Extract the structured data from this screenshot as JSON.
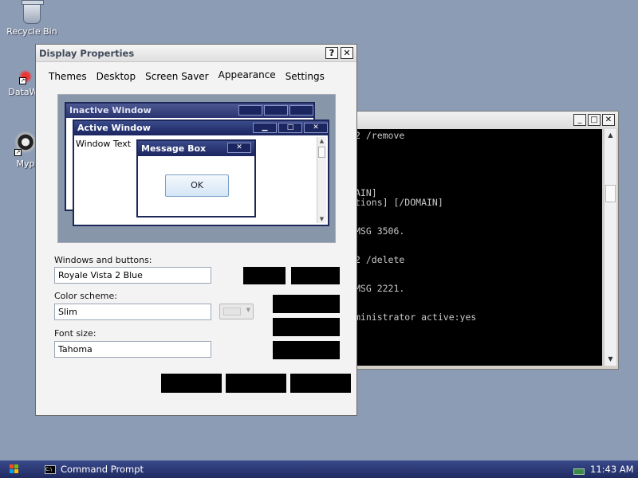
{
  "desktop": {
    "icons": [
      {
        "label": "Recycle Bin",
        "icon": "recycle-bin-icon"
      },
      {
        "label": "DataWa",
        "icon": "datawa-app-icon"
      },
      {
        "label": "Myp",
        "icon": "myp-app-icon"
      }
    ]
  },
  "cmd_window": {
    "title_buttons": [
      "_",
      "□",
      "✕"
    ],
    "console_lines": [
      "2 /remove",
      "",
      "",
      "",
      "",
      "",
      "AIN]",
      "tions] [/DOMAIN]",
      "",
      "",
      "MSG 3506.",
      "",
      "",
      "2 /delete",
      "",
      "",
      "MSG 2221.",
      "",
      "",
      "ministrator active:yes"
    ]
  },
  "dialog": {
    "title": "Display Properties",
    "help_button": "?",
    "close_button": "✕",
    "tabs": [
      "Themes",
      "Desktop",
      "Screen Saver",
      "Appearance",
      "Settings"
    ],
    "active_tab": "Appearance",
    "preview": {
      "inactive_title": "Inactive Window",
      "active_title": "Active Window",
      "window_text": "Window Text",
      "message_box_title": "Message Box",
      "ok_label": "OK"
    },
    "windows_buttons_label": "Windows and buttons:",
    "windows_buttons_value": "Royale Vista 2 Blue",
    "color_scheme_label": "Color scheme:",
    "color_scheme_value": "Slim",
    "font_size_label": "Font size:",
    "font_size_value": "Tahoma"
  },
  "taskbar": {
    "task_label": "Command Prompt",
    "clock": "11:43 AM"
  }
}
